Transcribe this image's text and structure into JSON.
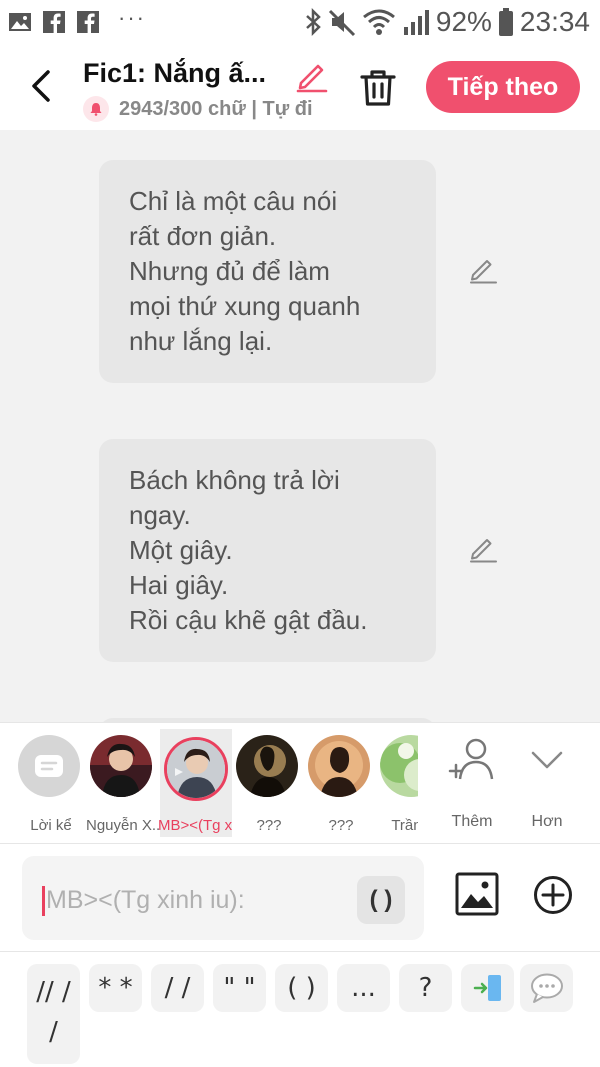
{
  "status_bar": {
    "battery": "92%",
    "time": "23:34",
    "dots": "···"
  },
  "header": {
    "title": "Fic1: Nắng ấ...",
    "subtitle": "2943/300 chữ | Tự đi",
    "next_label": "Tiếp theo"
  },
  "messages": [
    {
      "text": "Chỉ là một câu nói\nrất đơn giản.\nNhưng đủ để làm\nmọi thứ xung quanh\nnhư lắng lại."
    },
    {
      "text": "Bách không trả lời\nngay.\nMột giây.\nHai giây.\nRồi cậu khẽ gật đầu."
    }
  ],
  "characters": [
    {
      "name": "Lời kể",
      "icon": "narrator-icon",
      "selected": false
    },
    {
      "name": "Nguyễn X...",
      "icon": "avatar-photo",
      "selected": false
    },
    {
      "name": "MB><(Tg x...",
      "icon": "avatar-photo",
      "selected": true
    },
    {
      "name": "???",
      "icon": "avatar-silhouette",
      "selected": false
    },
    {
      "name": "???",
      "icon": "avatar-silhouette",
      "selected": false
    },
    {
      "name": "Trần T",
      "icon": "avatar-photo",
      "selected": false
    }
  ],
  "bar_actions": {
    "add_label": "Thêm",
    "more_label": "Hơn"
  },
  "input": {
    "placeholder": "MB><(Tg xinh iu):",
    "paren_label": "( )"
  },
  "quick_symbols": [
    "// /\n/",
    "* *",
    "/ /",
    "\" \"",
    "( )",
    "...",
    "?"
  ],
  "colors": {
    "accent": "#f0506e",
    "bubble": "#e7e7e7",
    "chat_bg": "#f2f2f2"
  }
}
